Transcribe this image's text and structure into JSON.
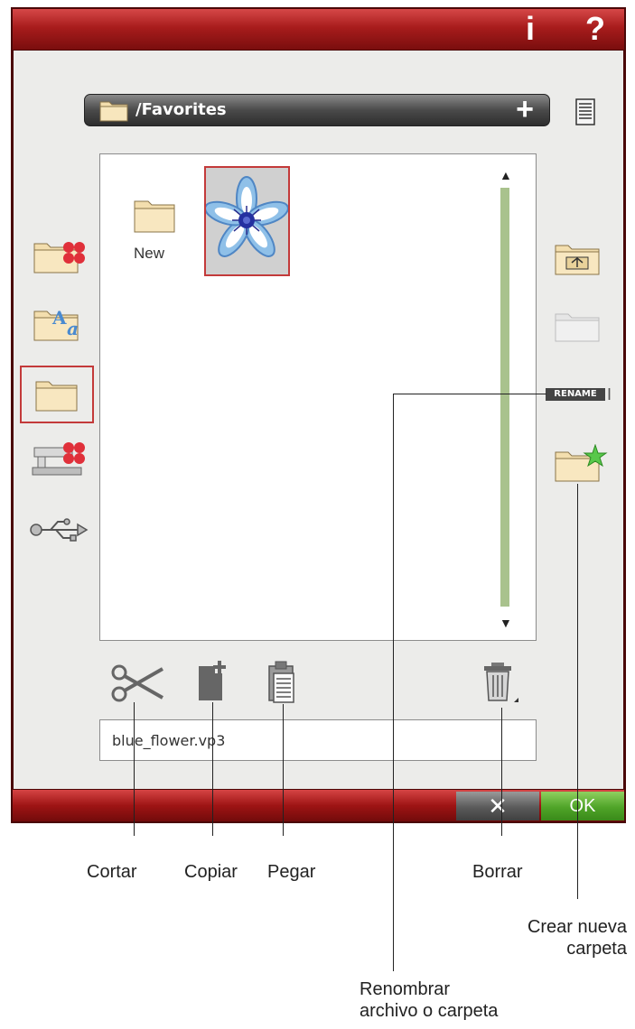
{
  "header": {
    "info_label": "i",
    "help_label": "?"
  },
  "path": {
    "text": "/Favorites",
    "add_label": "+"
  },
  "files": {
    "folder_label": "New"
  },
  "side_tags": {
    "rename": "RENAME"
  },
  "filename": {
    "value": "blue_flower.vp3"
  },
  "footer": {
    "cancel_label": "✕",
    "ok_label": "OK"
  },
  "callouts": {
    "cut": "Cortar",
    "copy": "Copiar",
    "paste": "Pegar",
    "delete": "Borrar",
    "new_folder_line1": "Crear nueva",
    "new_folder_line2": "carpeta",
    "rename_line1": "Renombrar",
    "rename_line2": "archivo o carpeta"
  },
  "colors": {
    "accent": "#a81c1c",
    "ok": "#4fa428",
    "selection": "#c33a3a",
    "scroll": "#a9c28d"
  }
}
